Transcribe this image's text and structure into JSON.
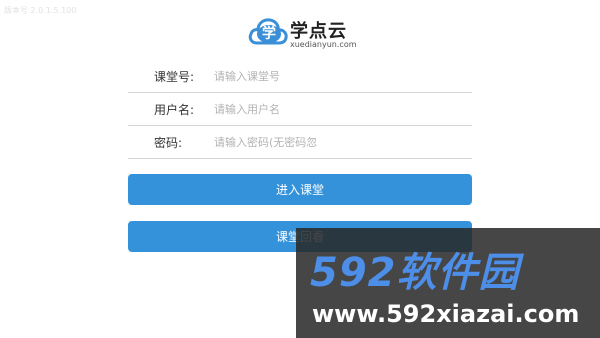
{
  "version_text": "版本号 2.0.1.5.100",
  "logo": {
    "glyph": "学",
    "brand": "学点云",
    "domain": "xuedianyun.com",
    "cloud_color": "#3a8fd6"
  },
  "form": {
    "classroom": {
      "label": "课堂号:",
      "placeholder": "请输入课堂号",
      "value": ""
    },
    "username": {
      "label": "用户名:",
      "placeholder": "请输入用户名",
      "value": ""
    },
    "password": {
      "label": "密码:",
      "placeholder": "请输入密码(无密码忽",
      "value": ""
    }
  },
  "buttons": {
    "enter_label": "进入课堂",
    "replay_label": "课堂回看",
    "color": "#3492db"
  },
  "watermark": {
    "title": "592软件园",
    "url": "www.592xiazai.com"
  }
}
